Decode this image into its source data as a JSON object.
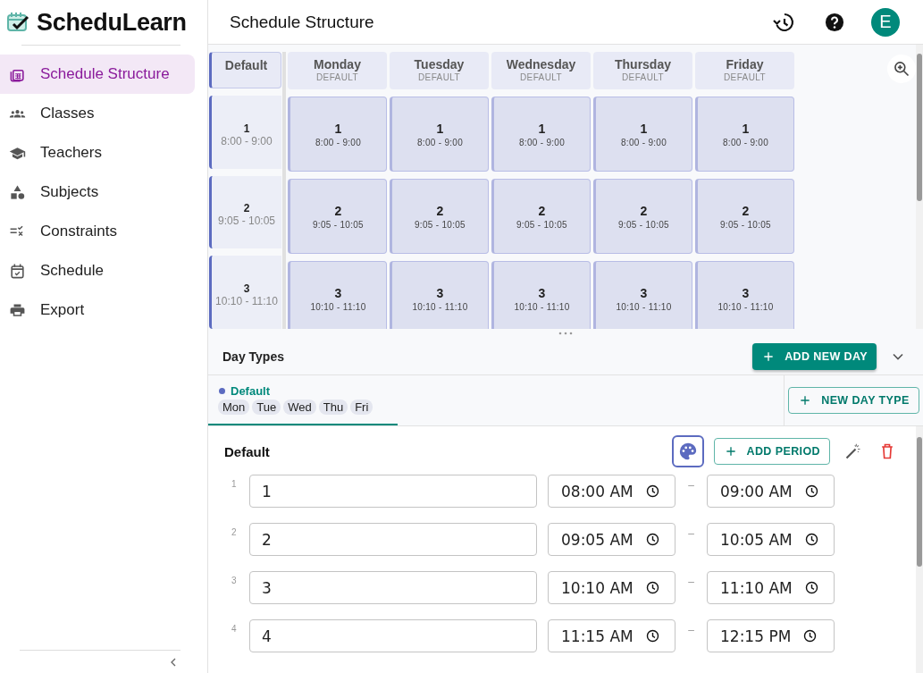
{
  "brand": {
    "name": "ScheduLearn"
  },
  "sidebar": {
    "items": [
      {
        "label": "Schedule Structure",
        "selected": true
      },
      {
        "label": "Classes",
        "selected": false
      },
      {
        "label": "Teachers",
        "selected": false
      },
      {
        "label": "Subjects",
        "selected": false
      },
      {
        "label": "Constraints",
        "selected": false
      },
      {
        "label": "Schedule",
        "selected": false
      },
      {
        "label": "Export",
        "selected": false
      }
    ]
  },
  "header": {
    "title": "Schedule Structure",
    "avatar": "E"
  },
  "grid": {
    "corner": "Default",
    "periods": [
      {
        "number": "1",
        "time": "8:00 - 9:00"
      },
      {
        "number": "2",
        "time": "9:05 - 10:05"
      },
      {
        "number": "3",
        "time": "10:10 - 11:10"
      }
    ],
    "days": [
      {
        "name": "Monday",
        "type": "DEFAULT",
        "cells": [
          {
            "number": "1",
            "time": "8:00 - 9:00"
          },
          {
            "number": "2",
            "time": "9:05 - 10:05"
          },
          {
            "number": "3",
            "time": "10:10 - 11:10"
          }
        ]
      },
      {
        "name": "Tuesday",
        "type": "DEFAULT",
        "cells": [
          {
            "number": "1",
            "time": "8:00 - 9:00"
          },
          {
            "number": "2",
            "time": "9:05 - 10:05"
          },
          {
            "number": "3",
            "time": "10:10 - 11:10"
          }
        ]
      },
      {
        "name": "Wednesday",
        "type": "DEFAULT",
        "cells": [
          {
            "number": "1",
            "time": "8:00 - 9:00"
          },
          {
            "number": "2",
            "time": "9:05 - 10:05"
          },
          {
            "number": "3",
            "time": "10:10 - 11:10"
          }
        ]
      },
      {
        "name": "Thursday",
        "type": "DEFAULT",
        "cells": [
          {
            "number": "1",
            "time": "8:00 - 9:00"
          },
          {
            "number": "2",
            "time": "9:05 - 10:05"
          },
          {
            "number": "3",
            "time": "10:10 - 11:10"
          }
        ]
      },
      {
        "name": "Friday",
        "type": "DEFAULT",
        "cells": [
          {
            "number": "1",
            "time": "8:00 - 9:00"
          },
          {
            "number": "2",
            "time": "9:05 - 10:05"
          },
          {
            "number": "3",
            "time": "10:10 - 11:10"
          }
        ]
      }
    ]
  },
  "day_types": {
    "title": "Day Types",
    "add_button": "ADD NEW DAY",
    "new_type_button": "NEW DAY TYPE",
    "tabs": [
      {
        "name": "Default",
        "color": "#5c6bc0",
        "selected": true,
        "days": [
          "Mon",
          "Tue",
          "Wed",
          "Thu",
          "Fri"
        ]
      }
    ]
  },
  "editor": {
    "title": "Default",
    "add_button": "ADD PERIOD",
    "periods": [
      {
        "index": "1",
        "name": "1",
        "start": "08:00 AM",
        "separator": "–",
        "end": "09:00 AM"
      },
      {
        "index": "2",
        "name": "2",
        "start": "09:05 AM",
        "separator": "–",
        "end": "10:05 AM"
      },
      {
        "index": "3",
        "name": "3",
        "start": "10:10 AM",
        "separator": "–",
        "end": "11:10 AM"
      },
      {
        "index": "4",
        "name": "4",
        "start": "11:15 AM",
        "separator": "–",
        "end": "12:15 PM"
      }
    ]
  }
}
